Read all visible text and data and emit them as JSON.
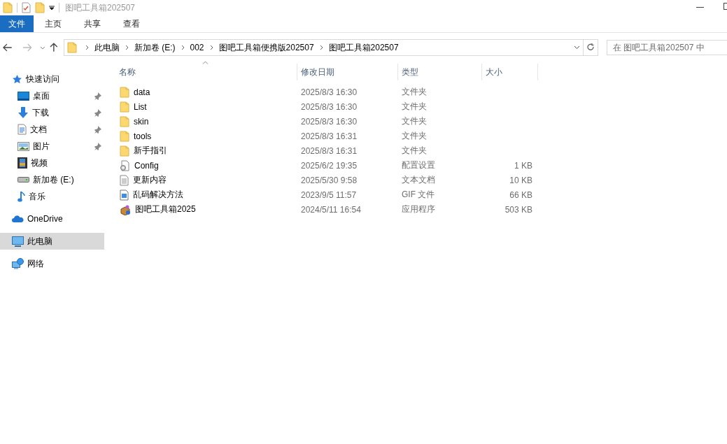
{
  "window": {
    "title": "图吧工具箱202507"
  },
  "ribbon_tabs": [
    {
      "label": "文件",
      "kind": "file",
      "selected": true
    },
    {
      "label": "主页",
      "kind": "tab",
      "selected": false
    },
    {
      "label": "共享",
      "kind": "tab",
      "selected": false
    },
    {
      "label": "查看",
      "kind": "tab",
      "selected": false
    }
  ],
  "address_bar": {
    "path": [
      "此电脑",
      "新加卷 (E:)",
      "002",
      "图吧工具箱便携版202507",
      "图吧工具箱202507"
    ]
  },
  "search": {
    "placeholder": "在 图吧工具箱202507 中"
  },
  "sidebar": {
    "items": [
      {
        "label": "快速访问",
        "kind": "star",
        "pinned": false,
        "selected": false,
        "children": [
          {
            "label": "桌面",
            "kind": "desktop",
            "pinned": true,
            "selected": false
          },
          {
            "label": "下载",
            "kind": "download",
            "pinned": true,
            "selected": false
          },
          {
            "label": "文档",
            "kind": "document",
            "pinned": true,
            "selected": false
          },
          {
            "label": "图片",
            "kind": "picture",
            "pinned": true,
            "selected": false
          },
          {
            "label": "视频",
            "kind": "video",
            "pinned": false,
            "selected": false
          },
          {
            "label": "新加卷 (E:)",
            "kind": "drive",
            "pinned": false,
            "selected": false
          },
          {
            "label": "音乐",
            "kind": "music",
            "pinned": false,
            "selected": false
          }
        ]
      },
      {
        "label": "OneDrive",
        "kind": "cloud",
        "pinned": false,
        "selected": false
      },
      {
        "label": "此电脑",
        "kind": "computer",
        "pinned": false,
        "selected": true
      },
      {
        "label": "网络",
        "kind": "network",
        "pinned": false,
        "selected": false
      }
    ]
  },
  "table": {
    "columns": [
      "名称",
      "修改日期",
      "类型",
      "大小"
    ],
    "rows": [
      {
        "name": "data",
        "modified": "2025/8/3 16:30",
        "type": "文件夹",
        "kind": "folder"
      },
      {
        "name": "List",
        "modified": "2025/8/3 16:30",
        "type": "文件夹",
        "kind": "folder"
      },
      {
        "name": "skin",
        "modified": "2025/8/3 16:30",
        "type": "文件夹",
        "kind": "folder"
      },
      {
        "name": "tools",
        "modified": "2025/8/3 16:31",
        "type": "文件夹",
        "kind": "folder"
      },
      {
        "name": "新手指引",
        "modified": "2025/8/3 16:31",
        "type": "文件夹",
        "kind": "folder"
      },
      {
        "name": "Config",
        "modified": "2025/6/2 19:35",
        "type": "配置设置",
        "size": "1 KB",
        "kind": "config"
      },
      {
        "name": "更新内容",
        "modified": "2025/5/30 9:58",
        "type": "文本文档",
        "size": "10 KB",
        "kind": "text"
      },
      {
        "name": "乱码解决方法",
        "modified": "2023/9/5 11:57",
        "type": "GIF 文件",
        "size": "66 KB",
        "kind": "image"
      },
      {
        "name": "图吧工具箱2025",
        "modified": "2024/5/11 16:54",
        "type": "应用程序",
        "size": "503 KB",
        "kind": "app"
      }
    ]
  }
}
